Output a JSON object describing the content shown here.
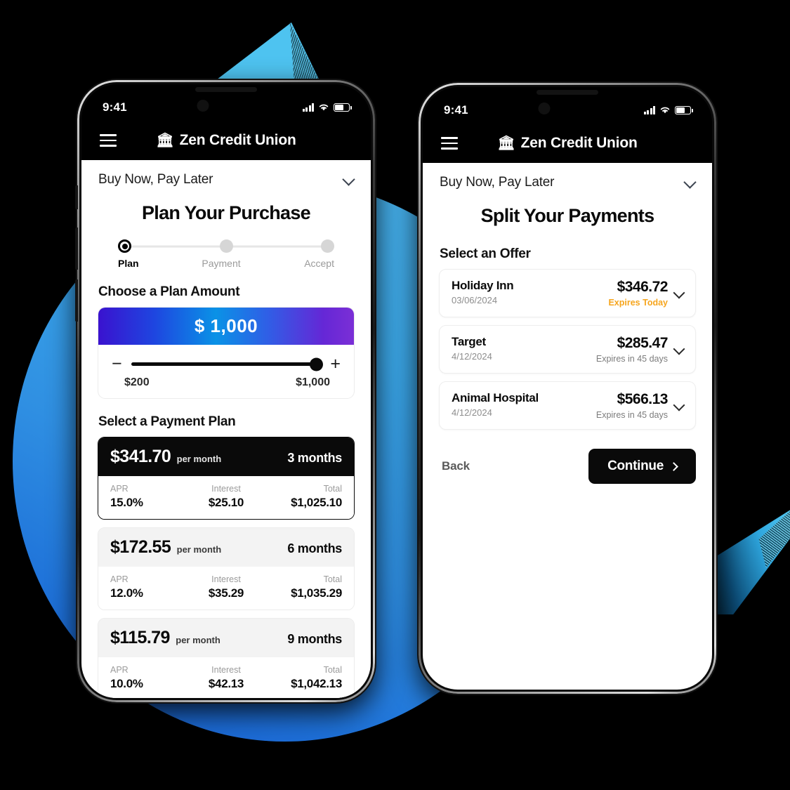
{
  "background": {
    "circle_color": "#3BA7E8",
    "triangle_color": "#4EC3F0",
    "diamond_color": "#2EA6DE",
    "page_color": "#000000"
  },
  "status_bar": {
    "time": "9:41",
    "signal_icon": "cellular-signal-icon",
    "wifi_icon": "wifi-icon",
    "battery_icon": "battery-icon"
  },
  "app_bar": {
    "menu_icon": "hamburger-menu-icon",
    "bank_icon": "🏛",
    "brand": "Zen Credit Union"
  },
  "left_phone": {
    "sheet_label": "Buy Now, Pay Later",
    "collapse_icon": "chevron-down-icon",
    "title": "Plan Your Purchase",
    "steps": [
      {
        "label": "Plan",
        "active": true
      },
      {
        "label": "Payment",
        "active": false
      },
      {
        "label": "Accept",
        "active": false
      }
    ],
    "amount_section_label": "Choose a Plan Amount",
    "amount_value": "$ 1,000",
    "decrement_icon": "minus-icon",
    "increment_icon": "plus-icon",
    "slider_min": "$200",
    "slider_max": "$1,000",
    "plan_section_label": "Select a Payment Plan",
    "detail_headers": {
      "apr": "APR",
      "interest": "Interest",
      "total": "Total"
    },
    "plans": [
      {
        "monthly": "$341.70",
        "per_month": "per month",
        "term": "3 months",
        "apr": "15.0%",
        "interest": "$25.10",
        "total": "$1,025.10",
        "selected": true
      },
      {
        "monthly": "$172.55",
        "per_month": "per month",
        "term": "6 months",
        "apr": "12.0%",
        "interest": "$35.29",
        "total": "$1,035.29",
        "selected": false
      },
      {
        "monthly": "$115.79",
        "per_month": "per month",
        "term": "9 months",
        "apr": "10.0%",
        "interest": "$42.13",
        "total": "$1,042.13",
        "selected": false
      }
    ]
  },
  "right_phone": {
    "sheet_label": "Buy Now, Pay Later",
    "collapse_icon": "chevron-down-icon",
    "title": "Split Your Payments",
    "offers_label": "Select an Offer",
    "expand_icon": "chevron-down-icon",
    "offers": [
      {
        "merchant": "Holiday Inn",
        "date": "03/06/2024",
        "amount": "$346.72",
        "expires": "Expires Today",
        "urgent": true
      },
      {
        "merchant": "Target",
        "date": "4/12/2024",
        "amount": "$285.47",
        "expires": "Expires in 45 days",
        "urgent": false
      },
      {
        "merchant": "Animal Hospital",
        "date": "4/12/2024",
        "amount": "$566.13",
        "expires": "Expires in 45 days",
        "urgent": false
      }
    ],
    "back_label": "Back",
    "continue_label": "Continue",
    "continue_arrow_icon": "chevron-right-icon",
    "urgent_color": "#F6A51D"
  }
}
